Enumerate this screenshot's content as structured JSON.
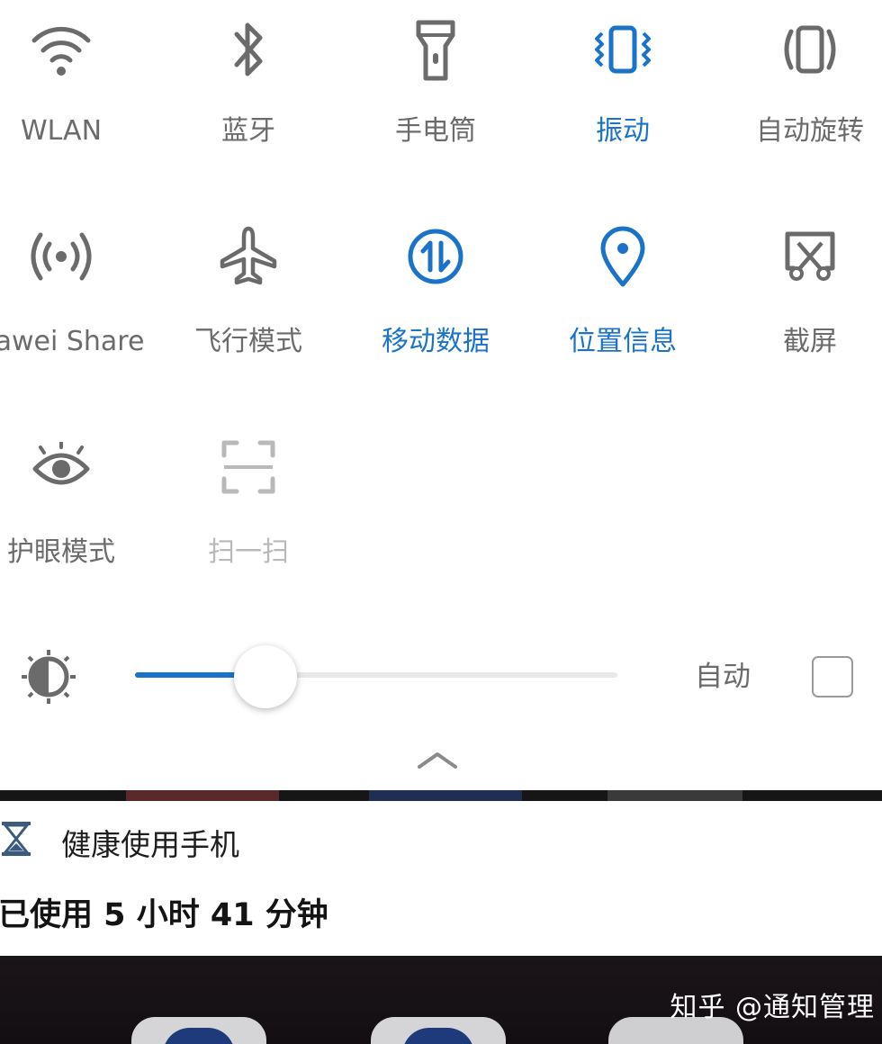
{
  "quick_settings": {
    "tiles": [
      {
        "label": "WLAN",
        "icon": "wifi-icon",
        "state": "off"
      },
      {
        "label": "蓝牙",
        "icon": "bluetooth-icon",
        "state": "off"
      },
      {
        "label": "手电筒",
        "icon": "flashlight-icon",
        "state": "off"
      },
      {
        "label": "振动",
        "icon": "vibrate-icon",
        "state": "on"
      },
      {
        "label": "自动旋转",
        "icon": "auto-rotate-icon",
        "state": "off"
      },
      {
        "label": "uawei Share",
        "icon": "huawei-share-icon",
        "state": "off"
      },
      {
        "label": "飞行模式",
        "icon": "airplane-icon",
        "state": "off"
      },
      {
        "label": "移动数据",
        "icon": "mobile-data-icon",
        "state": "on"
      },
      {
        "label": "位置信息",
        "icon": "location-icon",
        "state": "on"
      },
      {
        "label": "截屏",
        "icon": "screenshot-icon",
        "state": "off"
      },
      {
        "label": "护眼模式",
        "icon": "eye-comfort-icon",
        "state": "off"
      },
      {
        "label": "扫一扫",
        "icon": "scan-icon",
        "state": "disabled"
      }
    ],
    "brightness": {
      "icon": "brightness-icon",
      "level": 0.27,
      "auto_label": "自动",
      "auto_checked": false
    },
    "collapse_icon": "chevron-up-icon"
  },
  "notification": {
    "icon": "hourglass-icon",
    "title": "健康使用手机",
    "body": "已使用 5 小时 41 分钟"
  },
  "watermark": "知乎 @通知管理",
  "colors": {
    "active": "#1a73c8",
    "inactive": "#6b6b6b",
    "disabled": "#b9b9b9"
  }
}
